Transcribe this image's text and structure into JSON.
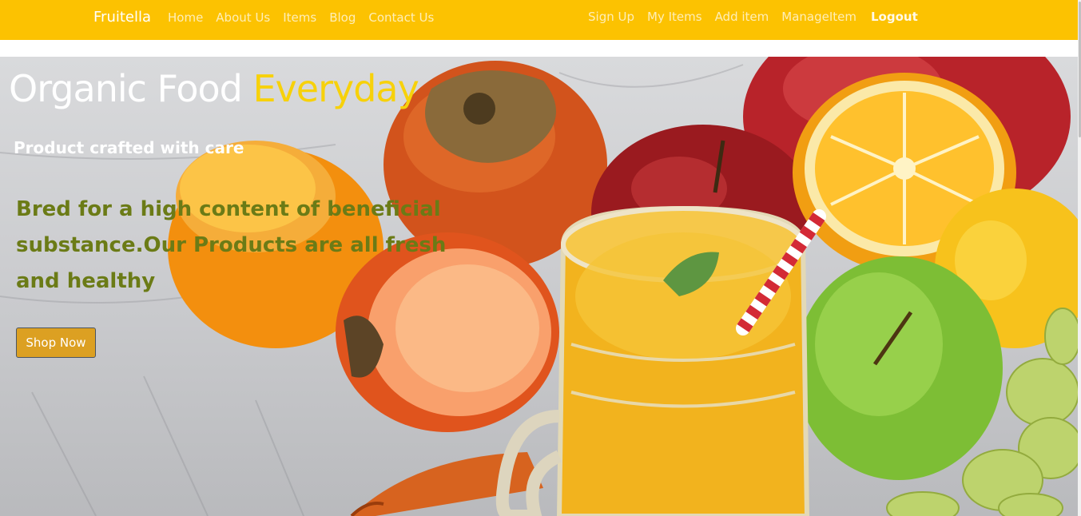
{
  "navbar": {
    "brand": "Fruitella",
    "left_links": [
      "Home",
      "About Us",
      "Items",
      "Blog",
      "Contact Us"
    ],
    "right_links": [
      "Sign Up",
      "My Items",
      "Add item",
      "ManageItem"
    ],
    "logout_label": "Logout",
    "background_color": "#fcc201"
  },
  "hero": {
    "title_main": "Organic Food ",
    "title_accent": "Everyday",
    "subtitle": "Product crafted with care",
    "description": "Bred for a high content of beneficial substance.Our Products are all fresh and healthy",
    "button_label": "Shop Now",
    "accent_color": "#f7d10a",
    "description_color": "#6b7b16",
    "button_color": "#dca022"
  }
}
